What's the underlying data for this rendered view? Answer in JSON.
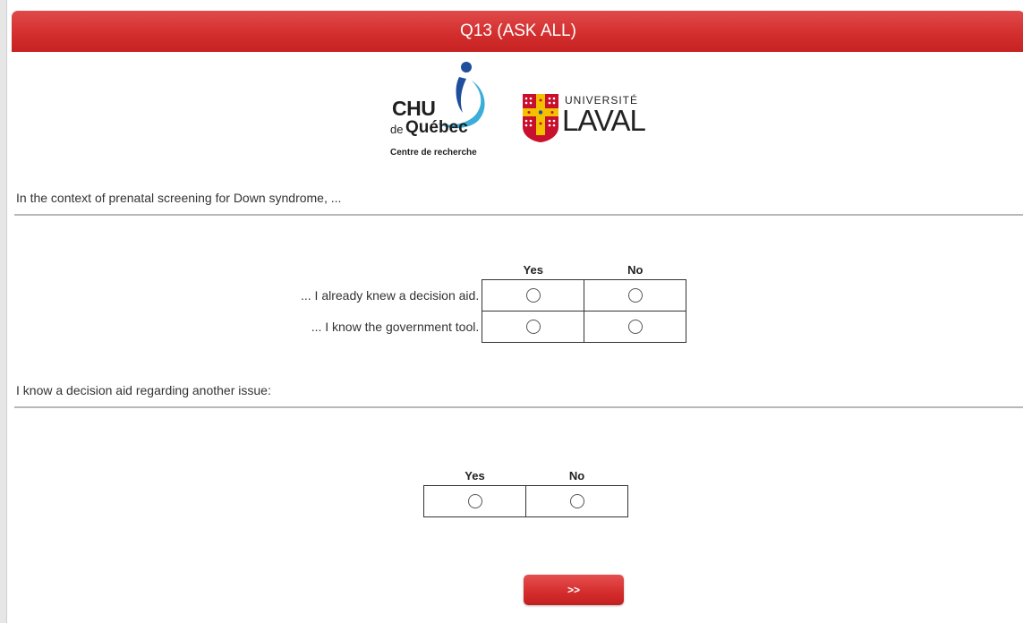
{
  "header": {
    "title": "Q13 (ASK ALL)"
  },
  "logos": {
    "chu": {
      "line1": "CHU",
      "de": "de",
      "quebec": "Québec",
      "subtitle": "Centre de recherche"
    },
    "laval": {
      "small": "UNIVERSITÉ",
      "big": "LAVAL"
    }
  },
  "question1": {
    "text": "In the context of prenatal screening for Down syndrome, ...",
    "columns": [
      "Yes",
      "No"
    ],
    "rows": [
      {
        "label": "... I already knew a decision aid."
      },
      {
        "label": "... I know the government tool."
      }
    ]
  },
  "question2": {
    "text": "I know a decision aid regarding another issue:",
    "columns": [
      "Yes",
      "No"
    ]
  },
  "navigation": {
    "next_label": ">>"
  },
  "colors": {
    "header_red": "#d42f2f",
    "button_red": "#d42c2c"
  }
}
